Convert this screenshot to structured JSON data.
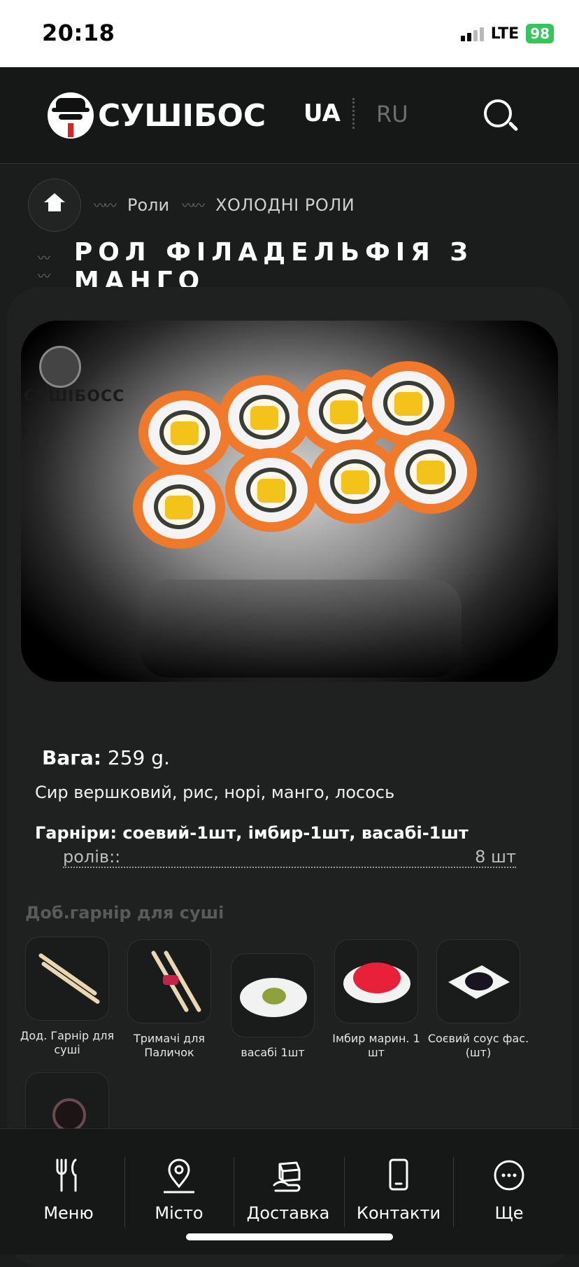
{
  "status_bar": {
    "time": "20:18",
    "network": "LTE",
    "battery": "98"
  },
  "header": {
    "logo_text": "СУШІБОС",
    "lang_active": "UA",
    "lang_inactive": "RU"
  },
  "breadcrumb": {
    "items": [
      "Роли",
      "ХОЛОДНІ РОЛИ"
    ]
  },
  "product": {
    "title": "РОЛ ФІЛАДЕЛЬФІЯ З МАНГО",
    "watermark_text": "СУШІБОСС",
    "weight_label": "Вага:",
    "weight_value": "259 g.",
    "ingredients": "Сир вершковий, рис, норі, манго, лосось",
    "garnish": "Гарніри: соевий-1шт, імбир-1шт, васабі-1шт",
    "rolls_label": "ролів::",
    "rolls_value": "8 шт"
  },
  "addons": {
    "title": "Доб.гарнір для суші",
    "items": [
      {
        "label": "Дод. Гарнір для суші",
        "icon": "chopsticks-icon"
      },
      {
        "label": "Тримачі для Паличок",
        "icon": "chopstick-holder-icon"
      },
      {
        "label": "васабі 1шт",
        "icon": "wasabi-icon"
      },
      {
        "label": "Імбир марин. 1 шт",
        "icon": "ginger-icon"
      },
      {
        "label": "Соєвий соус фас. (шт)",
        "icon": "soy-sauce-icon"
      }
    ]
  },
  "bottom_nav": {
    "items": [
      {
        "label": "Меню",
        "icon": "cutlery-icon"
      },
      {
        "label": "Місто",
        "icon": "location-pin-icon"
      },
      {
        "label": "Доставка",
        "icon": "delivery-box-icon"
      },
      {
        "label": "Контакти",
        "icon": "phone-icon"
      },
      {
        "label": "Ще",
        "icon": "more-icon"
      }
    ]
  },
  "colors": {
    "background": "#1b1c1c",
    "salmon": "#f07a2a",
    "mango": "#f4c31a",
    "battery": "#33c759"
  }
}
